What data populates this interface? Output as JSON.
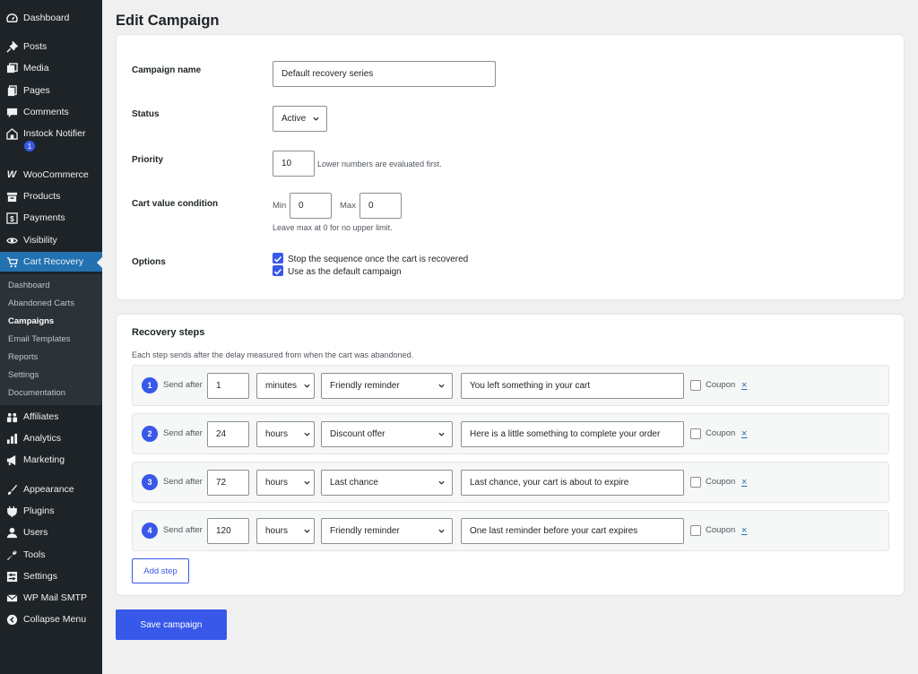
{
  "sidebar": {
    "items": [
      {
        "label": "Dashboard",
        "icon": "dashboard-icon"
      },
      {
        "label": "Posts",
        "icon": "pin-icon"
      },
      {
        "label": "Media",
        "icon": "media-icon"
      },
      {
        "label": "Pages",
        "icon": "pages-icon"
      },
      {
        "label": "Comments",
        "icon": "comment-icon"
      },
      {
        "label": "Instock Notifier",
        "icon": "store-icon",
        "badge": "1"
      },
      {
        "label": "WooCommerce",
        "icon": "woo-icon"
      },
      {
        "label": "Products",
        "icon": "archive-icon"
      },
      {
        "label": "Payments",
        "icon": "dollar-icon"
      },
      {
        "label": "Visibility",
        "icon": "eye-icon"
      },
      {
        "label": "Cart Recovery",
        "icon": "cart-icon",
        "active": true
      },
      {
        "label": "Affiliates",
        "icon": "groups-icon"
      },
      {
        "label": "Analytics",
        "icon": "chart-icon"
      },
      {
        "label": "Marketing",
        "icon": "megaphone-icon"
      },
      {
        "label": "Appearance",
        "icon": "brush-icon"
      },
      {
        "label": "Plugins",
        "icon": "plugin-icon"
      },
      {
        "label": "Users",
        "icon": "user-icon"
      },
      {
        "label": "Tools",
        "icon": "wrench-icon"
      },
      {
        "label": "Settings",
        "icon": "settings-icon"
      },
      {
        "label": "WP Mail SMTP",
        "icon": "mail-icon"
      },
      {
        "label": "Collapse Menu",
        "icon": "collapse-icon"
      }
    ],
    "submenu": [
      "Dashboard",
      "Abandoned Carts",
      "Campaigns",
      "Email Templates",
      "Reports",
      "Settings",
      "Documentation"
    ],
    "current_sub": "Campaigns"
  },
  "page": {
    "title": "Edit Campaign"
  },
  "form": {
    "campaign_name_label": "Campaign name",
    "campaign_name_value": "Default recovery series",
    "status_label": "Status",
    "status_value": "Active",
    "priority_label": "Priority",
    "priority_value": "10",
    "priority_help": "Lower numbers are evaluated first.",
    "cart_value_label": "Cart value condition",
    "min_label": "Min",
    "min_value": "0",
    "max_label": "Max",
    "max_value": "0",
    "cart_value_help": "Leave max at 0 for no upper limit.",
    "options_label": "Options",
    "option_stop": "Stop the sequence once the cart is recovered",
    "option_default": "Use as the default campaign"
  },
  "steps": {
    "title": "Recovery steps",
    "description": "Each step sends after the delay measured from when the cart was abandoned.",
    "send_after_label": "Send after",
    "coupon_label": "Coupon",
    "remove_label": "×",
    "items": [
      {
        "number": "1",
        "delay": "1",
        "unit": "minutes",
        "template": "Friendly reminder",
        "subject": "You left something in your cart"
      },
      {
        "number": "2",
        "delay": "24",
        "unit": "hours",
        "template": "Discount offer",
        "subject": "Here is a little something to complete your order"
      },
      {
        "number": "3",
        "delay": "72",
        "unit": "hours",
        "template": "Last chance",
        "subject": "Last chance, your cart is about to expire"
      },
      {
        "number": "4",
        "delay": "120",
        "unit": "hours",
        "template": "Friendly reminder",
        "subject": "One last reminder before your cart expires"
      }
    ],
    "add_step_label": "Add step"
  },
  "actions": {
    "save_label": "Save campaign"
  },
  "colors": {
    "sidebar_bg": "#1d2327",
    "submenu_bg": "#2c3338",
    "active_item": "#2271b1",
    "accent": "#3858e9",
    "page_bg": "#f0f0f1"
  }
}
